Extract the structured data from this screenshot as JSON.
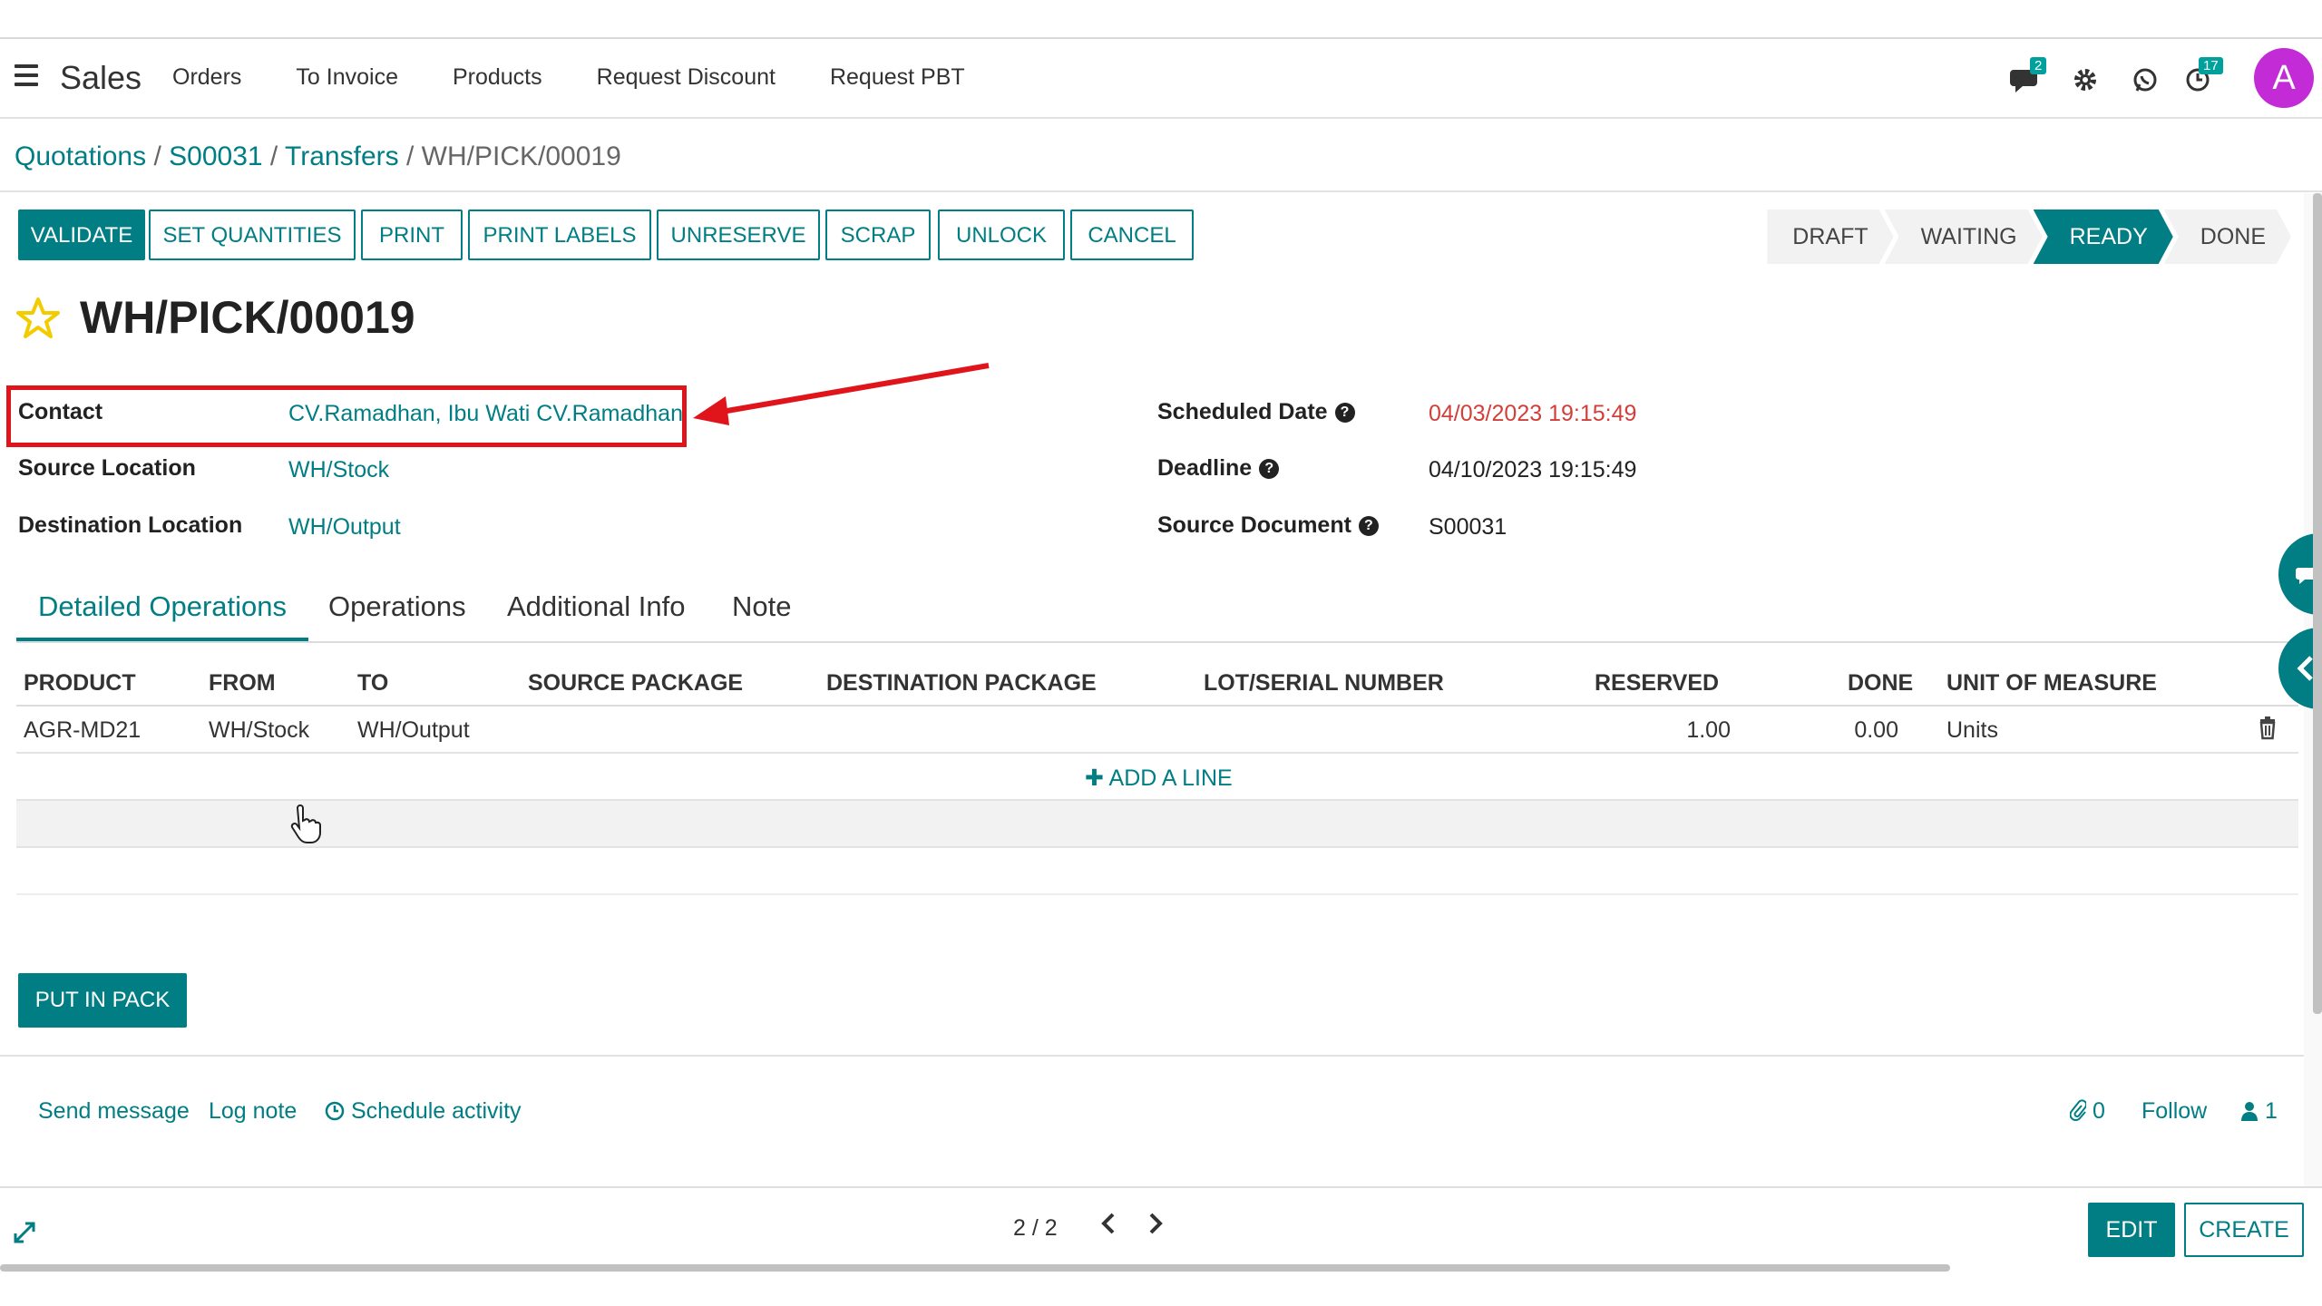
{
  "navbar": {
    "app_name": "Sales",
    "menu": [
      "Orders",
      "To Invoice",
      "Products",
      "Request Discount",
      "Request PBT"
    ],
    "messages_badge": "2",
    "activities_badge": "17",
    "avatar_letter": "A"
  },
  "breadcrumb": {
    "items": [
      "Quotations",
      "S00031",
      "Transfers"
    ],
    "current": "WH/PICK/00019",
    "separator": "/"
  },
  "actions": {
    "validate": "VALIDATE",
    "set_quantities": "SET QUANTITIES",
    "print": "PRINT",
    "print_labels": "PRINT LABELS",
    "unreserve": "UNRESERVE",
    "scrap": "SCRAP",
    "unlock": "UNLOCK",
    "cancel": "CANCEL"
  },
  "stages": {
    "items": [
      "DRAFT",
      "WAITING",
      "READY",
      "DONE"
    ],
    "active": "READY"
  },
  "record": {
    "title": "WH/PICK/00019"
  },
  "fields": {
    "contact_label": "Contact",
    "contact_value": "CV.Ramadhan, Ibu Wati CV.Ramadhan",
    "source_location_label": "Source Location",
    "source_location_value": "WH/Stock",
    "destination_location_label": "Destination Location",
    "destination_location_value": "WH/Output",
    "scheduled_date_label": "Scheduled Date",
    "scheduled_date_value": "04/03/2023 19:15:49",
    "deadline_label": "Deadline",
    "deadline_value": "04/10/2023 19:15:49",
    "source_document_label": "Source Document",
    "source_document_value": "S00031",
    "help_glyph": "?"
  },
  "tabs": [
    "Detailed Operations",
    "Operations",
    "Additional Info",
    "Note"
  ],
  "table": {
    "headers": [
      "PRODUCT",
      "FROM",
      "TO",
      "SOURCE PACKAGE",
      "DESTINATION PACKAGE",
      "LOT/SERIAL NUMBER",
      "RESERVED",
      "DONE",
      "UNIT OF MEASURE"
    ],
    "rows": [
      {
        "product": "AGR-MD21",
        "from": "WH/Stock",
        "to": "WH/Output",
        "reserved": "1.00",
        "done": "0.00",
        "uom": "Units"
      }
    ],
    "add_line": "ADD A LINE"
  },
  "put_in_pack": "PUT IN PACK",
  "chatter": {
    "send_message": "Send message",
    "log_note": "Log note",
    "schedule_activity": "Schedule activity",
    "attachments": "0",
    "follow": "Follow",
    "followers": "1"
  },
  "footer": {
    "pager": "2 / 2",
    "edit": "EDIT",
    "create": "CREATE"
  },
  "colors": {
    "primary": "#017e84",
    "highlight_red": "#e0151b",
    "date_red": "#d23f3a",
    "avatar": "#c32bd6",
    "star": "#f3cc00"
  },
  "icons": [
    "menu-icon",
    "chat-icon",
    "gear-icon",
    "whatsapp-icon",
    "clock-icon",
    "star-icon",
    "help-icon",
    "trash-icon",
    "plus-icon",
    "clock-icon",
    "paperclip-icon",
    "user-icon",
    "chevron-left-icon",
    "chevron-right-icon",
    "expand-icon",
    "chat-bubble-icon"
  ]
}
